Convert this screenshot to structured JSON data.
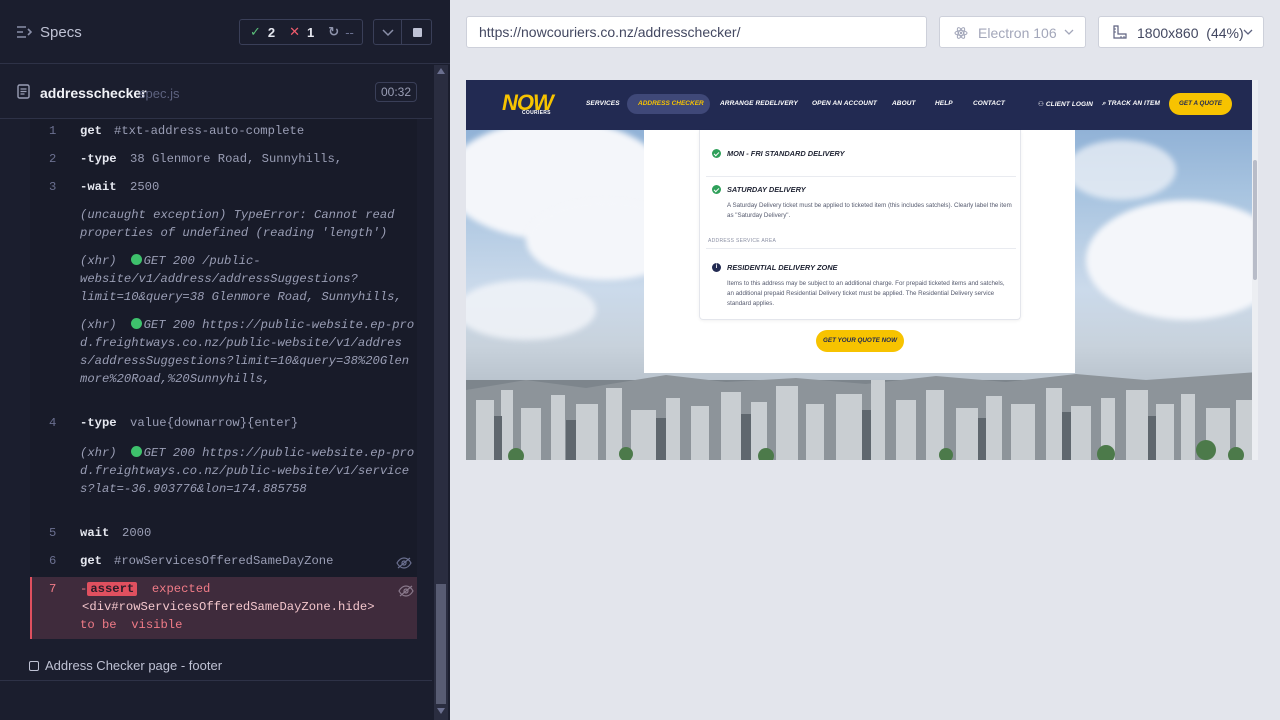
{
  "reporter": {
    "title": "Specs",
    "stats": {
      "passed": "2",
      "failed": "1",
      "pending": "--"
    },
    "spec": {
      "name": "addresschecker",
      "ext": "spec.js",
      "duration": "00:32"
    },
    "commands": [
      {
        "num": "1",
        "name": "get",
        "message": "#txt-address-auto-complete"
      },
      {
        "num": "2",
        "name": "-type",
        "message": "38 Glenmore Road, Sunnyhills,"
      },
      {
        "num": "3",
        "name": "-wait",
        "message": "2500"
      },
      {
        "num": "4",
        "name": "-type",
        "message": "value{downarrow}{enter}"
      },
      {
        "num": "5",
        "name": "wait",
        "message": "2000"
      },
      {
        "num": "6",
        "name": "get",
        "message": "#rowServicesOfferedSameDayZone"
      }
    ],
    "logs": {
      "exception": "(uncaught exception)  TypeError: Cannot read properties of undefined (reading 'length')",
      "xhr1_label": "(xhr)",
      "xhr1_text": "GET 200 /public-website/v1/address/addressSuggestions?limit=10&query=38 Glenmore Road, Sunnyhills,",
      "xhr2_label": "(xhr)",
      "xhr2_text": "GET 200 https://public-website.ep-prod.freightways.co.nz/public-website/v1/address/addressSuggestions?limit=10&query=38%20Glenmore%20Road,%20Sunnyhills,",
      "xhr3_label": "(xhr)",
      "xhr3_text": "GET 200 https://public-website.ep-prod.freightways.co.nz/public-website/v1/services?lat=-36.903776&lon=174.885758"
    },
    "error_command": {
      "num": "7",
      "dash": "-",
      "badge": "assert",
      "expected": "expected",
      "selector": "<div#rowServicesOfferedSameDayZone.hide>",
      "to_be": "to be",
      "visible": "visible"
    },
    "next_test": "Address Checker page - footer"
  },
  "toolbar": {
    "url": "https://nowcouriers.co.nz/addresschecker/",
    "browser": "Electron 106",
    "viewport": "1800x860",
    "zoom": "(44%)"
  },
  "site": {
    "logo": "NOW",
    "logo_sub": "COURIERS",
    "nav": [
      "SERVICES",
      "ADDRESS CHECKER",
      "ARRANGE REDELIVERY",
      "OPEN AN ACCOUNT",
      "ABOUT",
      "HELP",
      "CONTACT"
    ],
    "client_login": "CLIENT LOGIN",
    "track": "TRACK AN ITEM",
    "quote_btn": "GET A QUOTE",
    "services": [
      {
        "title": "MON - FRI STANDARD DELIVERY",
        "desc": ""
      },
      {
        "title": "SATURDAY DELIVERY",
        "desc": "A Saturday Delivery ticket must be applied to ticketed item (this includes satchels). Clearly label the item as \"Saturday Delivery\"."
      }
    ],
    "area_label": "ADDRESS SERVICE AREA",
    "zone": {
      "title": "RESIDENTIAL DELIVERY ZONE",
      "desc": "Items to this address may be subject to an additional charge. For prepaid ticketed items and satchels, an additional prepaid Residential Delivery ticket must be applied. The Residential Delivery service standard applies."
    },
    "cta": "GET YOUR QUOTE NOW"
  },
  "colors": {
    "pass": "#5bbf7a",
    "fail": "#ef5b6c",
    "brand_navy": "#222a52",
    "brand_yellow": "#f7c300"
  }
}
